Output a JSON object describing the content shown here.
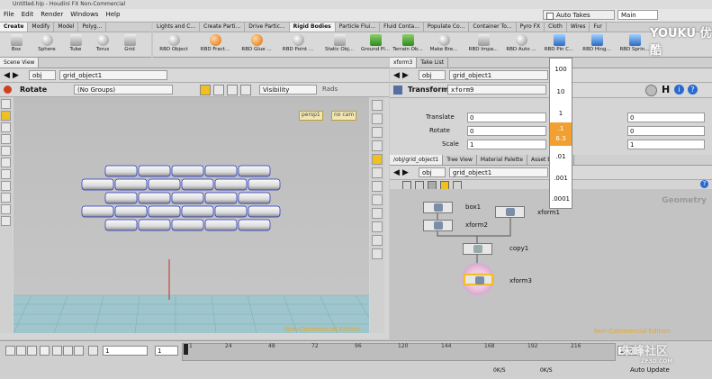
{
  "window": {
    "title": "Untitled.hip - Houdini FX Non-Commercial"
  },
  "menu": [
    "File",
    "Edit",
    "Render",
    "Windows",
    "Help"
  ],
  "top_right": {
    "auto_takes": "Auto Takes",
    "desktop": "Main"
  },
  "shelf_left": {
    "tabs": [
      "Create",
      "Modify",
      "Model",
      "Polyg..."
    ],
    "tools": [
      "Box",
      "Sphere",
      "Tube",
      "Torus",
      "Grid"
    ]
  },
  "shelf_right": {
    "tabs": [
      "Lights and C...",
      "Create Parti...",
      "Drive Partic...",
      "Rigid Bodies",
      "Particle Flui...",
      "Fluid Conta...",
      "Populate Co...",
      "Container To...",
      "Pyro FX",
      "Cloth",
      "Wires",
      "Fur"
    ],
    "tools": [
      "RBD Object",
      "RBD Fract...",
      "RBD Glue ...",
      "RBD Point ...",
      "Static Obj...",
      "Ground Pl...",
      "Terrain Ob...",
      "Make Bre...",
      "RBD Impa...",
      "RBD Auto ...",
      "RBD Pin C...",
      "RBD Hing...",
      "RBD Sprin..."
    ]
  },
  "left_pane": {
    "tabs": [
      "Scene View"
    ],
    "path": "obj",
    "path_node": "grid_object1",
    "tool_label": "Rotate",
    "group": "(No Groups)",
    "visibility": "Visibility",
    "rads": "Rads",
    "camera": [
      "persp1",
      "no cam"
    ],
    "watermark": "Non-Commercial Edition"
  },
  "right_pane": {
    "tabs": [
      "xform3",
      "Take List"
    ],
    "path": "obj",
    "path_node": "grid_object1",
    "op_type": "Transform",
    "op_name": "xform9",
    "params": [
      {
        "label": "Translate",
        "values": [
          "0",
          "",
          "0"
        ]
      },
      {
        "label": "Rotate",
        "values": [
          "0",
          "",
          "0"
        ]
      },
      {
        "label": "Scale",
        "values": [
          "1",
          "",
          "1"
        ]
      }
    ],
    "net_tabs": [
      "/obj/grid_object1",
      "Tree View",
      "Material Palette",
      "Asset Browser"
    ],
    "net_path": "obj",
    "net_path_node": "grid_object1",
    "net_context": "Geometry",
    "nodes": [
      "box1",
      "xform2",
      "xform1",
      "copy1",
      "xform3"
    ],
    "watermark": "Non-Commercial Edition"
  },
  "value_ladder": [
    "100",
    "10",
    "1",
    ".1",
    "6.3",
    ".01",
    ".001",
    ".0001"
  ],
  "timeline": {
    "current_frame": "1",
    "start_frame": "1",
    "ticks": [
      "1",
      "24",
      "48",
      "72",
      "96",
      "120",
      "144",
      "168",
      "192",
      "216",
      "240"
    ],
    "end": "240",
    "status": [
      "0K/S",
      "0K/S"
    ],
    "auto_update": "Auto Update"
  },
  "watermarks": {
    "youku": "YOUKU 优酷",
    "zf3d": "朱峰社区",
    "zf3d_url": "ZF3D.COM"
  },
  "colors": {
    "accent_orange": "#f2a030",
    "node_selected": "#f0c020",
    "nce_text": "#e0a830"
  }
}
